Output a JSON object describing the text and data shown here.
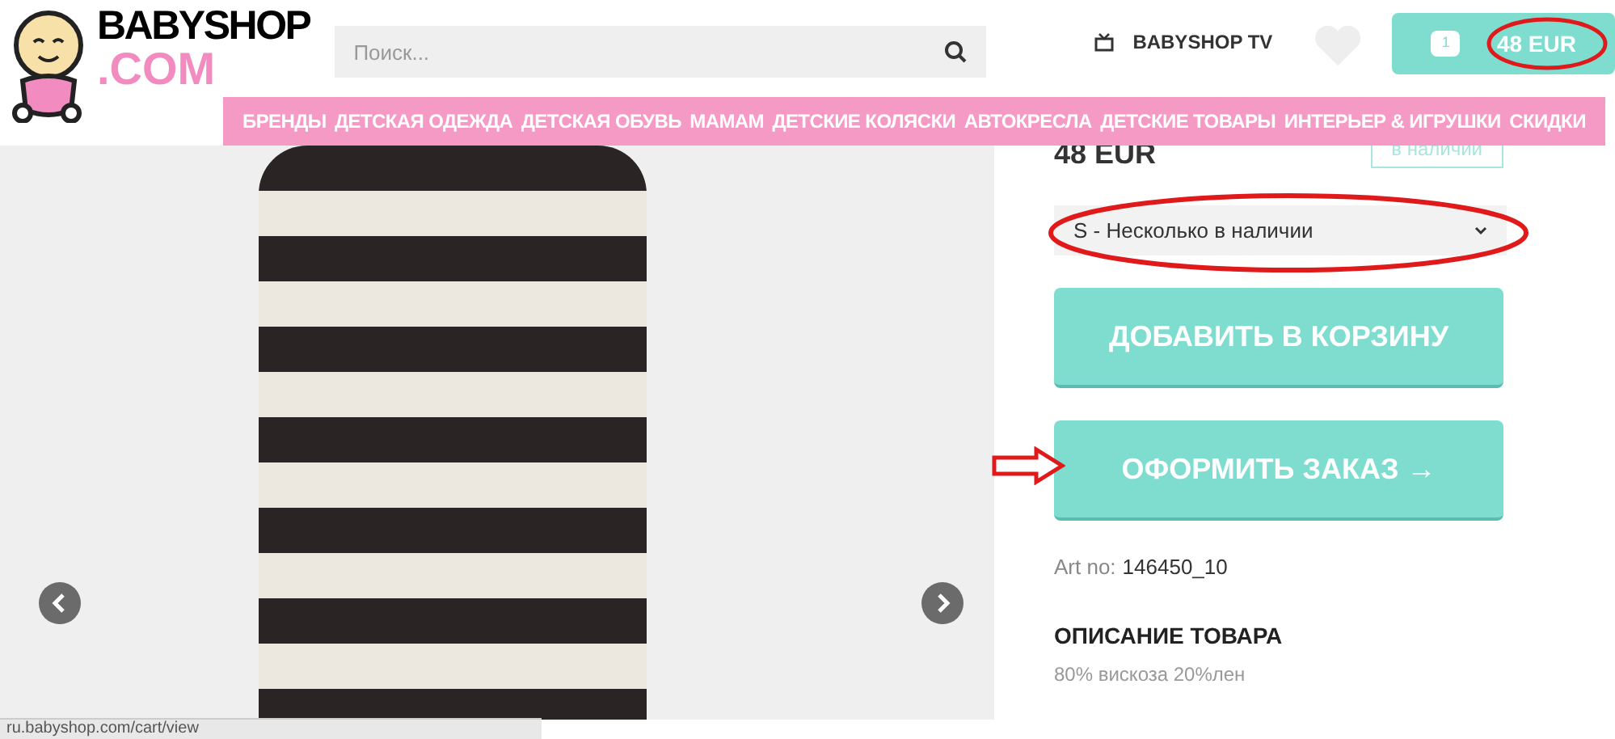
{
  "logo": {
    "name": "BABYSHOP",
    "domain": ".COM"
  },
  "search": {
    "placeholder": "Поиск..."
  },
  "tv_link": "BABYSHOP TV",
  "cart": {
    "total": "48 EUR",
    "count": "1"
  },
  "nav": [
    {
      "label": "БРЕНДЫ"
    },
    {
      "label": "ДЕТСКАЯ ОДЕЖДА"
    },
    {
      "label": "ДЕТСКАЯ ОБУВЬ"
    },
    {
      "label": "МАМАМ"
    },
    {
      "label": "ДЕТСКИЕ КОЛЯСКИ"
    },
    {
      "label": "АВТОКРЕСЛА"
    },
    {
      "label": "ДЕТСКИЕ ТОВАРЫ"
    },
    {
      "label": "ИНТЕРЬЕР & ИГРУШКИ"
    },
    {
      "label": "СКИДКИ"
    }
  ],
  "product": {
    "price": "48 EUR",
    "stock_badge": "в наличии",
    "size_select": "S - Несколько в наличии",
    "add_button": "ДОБАВИТЬ В КОРЗИНУ",
    "checkout_button": "ОФОРМИТЬ ЗАКАЗ →",
    "art_label": "Art no:",
    "art_number": "146450_10",
    "description_heading": "ОПИСАНИЕ ТОВАРА",
    "description": "80% вискоза 20%лен"
  },
  "status_bar": "ru.babyshop.com/cart/view"
}
